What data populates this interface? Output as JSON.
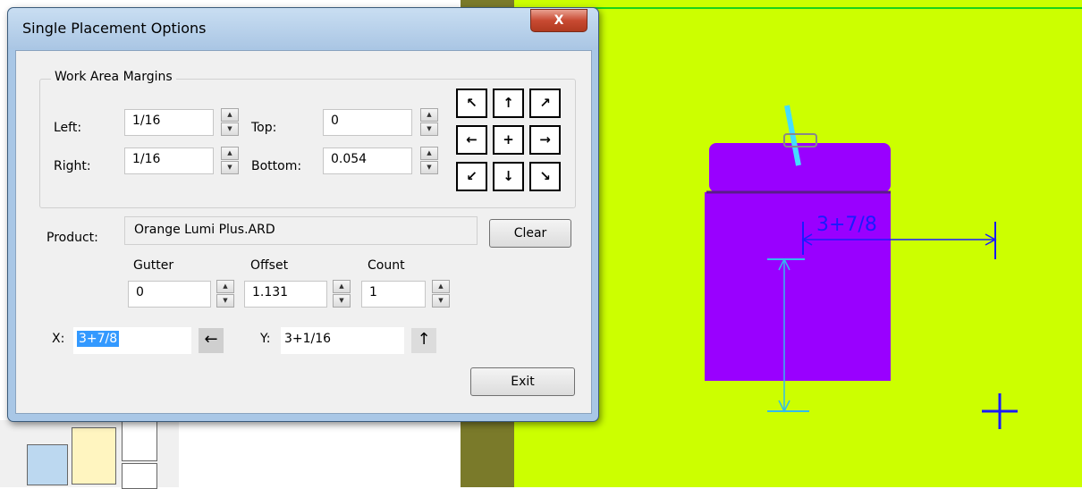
{
  "dialog": {
    "title": "Single Placement Options",
    "close_glyph": "X",
    "margins": {
      "group_label": "Work Area Margins",
      "left_label": "Left:",
      "left_value": "1/16",
      "right_label": "Right:",
      "right_value": "1/16",
      "top_label": "Top:",
      "top_value": "0",
      "bottom_label": "Bottom:",
      "bottom_value": "0.054"
    },
    "alignment_grid": [
      "arrow-up-left-icon",
      "arrow-up-icon",
      "arrow-up-right-icon",
      "arrow-left-icon",
      "plus-center-icon",
      "arrow-right-icon",
      "arrow-down-left-icon",
      "arrow-down-icon",
      "arrow-down-right-icon"
    ],
    "product_label": "Product:",
    "product_value": "Orange Lumi Plus.ARD",
    "clear_label": "Clear",
    "gutter_label": "Gutter",
    "gutter_value": "0",
    "offset_label": "Offset",
    "offset_value": "1.131",
    "count_label": "Count",
    "count_value": "1",
    "x_label": "X:",
    "x_value": "3+7/8",
    "y_label": "Y:",
    "y_value": "3+1/16",
    "exit_label": "Exit"
  },
  "canvas": {
    "background_color": "#ccff00",
    "product_color": "#9900ff",
    "dimension_label": "3+7/8"
  }
}
